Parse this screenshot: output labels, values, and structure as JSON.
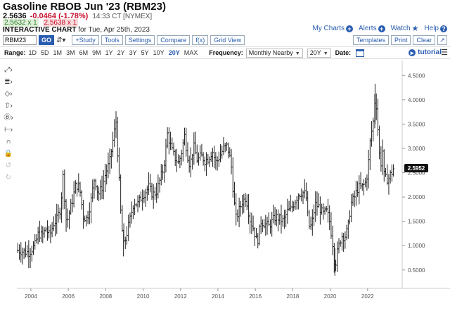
{
  "header": {
    "title": "Gasoline RBOB Jun '23 (RBM23)",
    "last": "2.5636",
    "change": "-0.0464 (-1.78%)",
    "timestamp": "14:33 CT [NYMEX]",
    "bid": "2.5632 x 1",
    "ask": "2.5638 x 1",
    "chart_label": "INTERACTIVE CHART",
    "chart_for": "for Tue, Apr 25th, 2023"
  },
  "links": {
    "my_charts": "My Charts",
    "alerts": "Alerts",
    "watch": "Watch",
    "help": "Help"
  },
  "toolbar": {
    "symbol": "RBM23",
    "go": "GO",
    "buttons": [
      "+Study",
      "Tools",
      "Settings",
      "Compare",
      "f(x)",
      "Grid View"
    ],
    "right_buttons": [
      "Templates",
      "Print",
      "Clear"
    ]
  },
  "range": {
    "label": "Range:",
    "options": [
      "1D",
      "5D",
      "1M",
      "3M",
      "6M",
      "9M",
      "1Y",
      "2Y",
      "3Y",
      "5Y",
      "10Y",
      "20Y",
      "MAX"
    ],
    "active": "20Y",
    "frequency_label": "Frequency:",
    "frequency_value": "Monthly Nearby",
    "period_value": "20Y",
    "date_label": "Date:",
    "tutorial": "tutorial"
  },
  "side_tools": [
    "arrow-line-icon",
    "fib-lines-icon",
    "diamond-marker-icon",
    "arrow-marker-icon",
    "price-marker-icon",
    "measure-icon",
    "magnet-icon",
    "lock-icon",
    "undo-icon",
    "redo-icon"
  ],
  "chart_data": {
    "type": "ohlc-bar",
    "frequency": "monthly",
    "x_tick_labels": [
      "2004",
      "2006",
      "2008",
      "2010",
      "2012",
      "2014",
      "2016",
      "2018",
      "2020",
      "2022"
    ],
    "y_tick_labels": [
      "0.5000",
      "1.0000",
      "1.5000",
      "2.0000",
      "2.5000",
      "3.0000",
      "3.5000",
      "4.0000",
      "4.5000"
    ],
    "ylim": [
      0.15,
      4.75
    ],
    "xlim": [
      2003.25,
      2023.85
    ],
    "current_price_label": "2.5952",
    "current_price": 2.5952,
    "series_close": [
      [
        2003.3,
        0.9
      ],
      [
        2003.6,
        0.88
      ],
      [
        2003.9,
        0.86
      ],
      [
        2004.2,
        1.0
      ],
      [
        2004.4,
        1.25
      ],
      [
        2004.6,
        1.2
      ],
      [
        2004.8,
        1.35
      ],
      [
        2005.0,
        1.2
      ],
      [
        2005.2,
        1.45
      ],
      [
        2005.4,
        1.55
      ],
      [
        2005.6,
        1.8
      ],
      [
        2005.7,
        2.5
      ],
      [
        2005.8,
        2.0
      ],
      [
        2005.9,
        1.45
      ],
      [
        2006.0,
        1.6
      ],
      [
        2006.2,
        1.9
      ],
      [
        2006.4,
        2.25
      ],
      [
        2006.6,
        2.2
      ],
      [
        2006.8,
        1.6
      ],
      [
        2007.0,
        1.55
      ],
      [
        2007.2,
        1.9
      ],
      [
        2007.4,
        2.4
      ],
      [
        2007.6,
        2.05
      ],
      [
        2007.8,
        2.2
      ],
      [
        2008.0,
        2.5
      ],
      [
        2008.2,
        2.7
      ],
      [
        2008.4,
        3.2
      ],
      [
        2008.55,
        3.55
      ],
      [
        2008.65,
        2.8
      ],
      [
        2008.8,
        1.7
      ],
      [
        2008.95,
        1.0
      ],
      [
        2009.1,
        1.2
      ],
      [
        2009.3,
        1.55
      ],
      [
        2009.5,
        1.9
      ],
      [
        2009.7,
        1.85
      ],
      [
        2009.9,
        2.0
      ],
      [
        2010.1,
        2.1
      ],
      [
        2010.3,
        2.2
      ],
      [
        2010.5,
        2.05
      ],
      [
        2010.7,
        2.1
      ],
      [
        2010.9,
        2.35
      ],
      [
        2011.1,
        2.6
      ],
      [
        2011.3,
        3.3
      ],
      [
        2011.5,
        3.0
      ],
      [
        2011.7,
        2.8
      ],
      [
        2011.9,
        2.7
      ],
      [
        2012.1,
        3.0
      ],
      [
        2012.2,
        3.3
      ],
      [
        2012.4,
        2.8
      ],
      [
        2012.5,
        2.65
      ],
      [
        2012.7,
        3.05
      ],
      [
        2012.9,
        2.75
      ],
      [
        2013.1,
        2.85
      ],
      [
        2013.3,
        2.75
      ],
      [
        2013.5,
        2.8
      ],
      [
        2013.7,
        2.95
      ],
      [
        2013.9,
        2.7
      ],
      [
        2014.1,
        2.85
      ],
      [
        2014.3,
        3.0
      ],
      [
        2014.5,
        3.05
      ],
      [
        2014.7,
        2.7
      ],
      [
        2014.8,
        2.2
      ],
      [
        2014.95,
        1.55
      ],
      [
        2015.1,
        1.7
      ],
      [
        2015.3,
        1.9
      ],
      [
        2015.5,
        2.0
      ],
      [
        2015.7,
        1.55
      ],
      [
        2015.9,
        1.35
      ],
      [
        2016.1,
        1.05
      ],
      [
        2016.3,
        1.5
      ],
      [
        2016.5,
        1.45
      ],
      [
        2016.7,
        1.4
      ],
      [
        2016.9,
        1.5
      ],
      [
        2017.1,
        1.6
      ],
      [
        2017.3,
        1.55
      ],
      [
        2017.5,
        1.5
      ],
      [
        2017.7,
        1.7
      ],
      [
        2017.9,
        1.75
      ],
      [
        2018.1,
        1.9
      ],
      [
        2018.3,
        2.05
      ],
      [
        2018.5,
        2.1
      ],
      [
        2018.7,
        2.05
      ],
      [
        2018.85,
        1.4
      ],
      [
        2019.0,
        1.4
      ],
      [
        2019.2,
        1.85
      ],
      [
        2019.4,
        1.8
      ],
      [
        2019.6,
        1.65
      ],
      [
        2019.8,
        1.7
      ],
      [
        2019.95,
        1.55
      ],
      [
        2020.15,
        1.0
      ],
      [
        2020.25,
        0.55
      ],
      [
        2020.4,
        0.9
      ],
      [
        2020.6,
        1.2
      ],
      [
        2020.8,
        1.2
      ],
      [
        2020.95,
        1.35
      ],
      [
        2021.1,
        1.85
      ],
      [
        2021.3,
        2.0
      ],
      [
        2021.5,
        2.2
      ],
      [
        2021.7,
        2.2
      ],
      [
        2021.9,
        2.3
      ],
      [
        2022.0,
        2.5
      ],
      [
        2022.15,
        3.2
      ],
      [
        2022.3,
        3.55
      ],
      [
        2022.4,
        4.05
      ],
      [
        2022.5,
        3.8
      ],
      [
        2022.6,
        3.0
      ],
      [
        2022.7,
        2.65
      ],
      [
        2022.8,
        2.95
      ],
      [
        2022.9,
        2.35
      ],
      [
        2023.0,
        2.4
      ],
      [
        2023.1,
        2.35
      ],
      [
        2023.2,
        2.45
      ],
      [
        2023.3,
        2.5
      ],
      [
        2023.4,
        2.6
      ]
    ]
  }
}
